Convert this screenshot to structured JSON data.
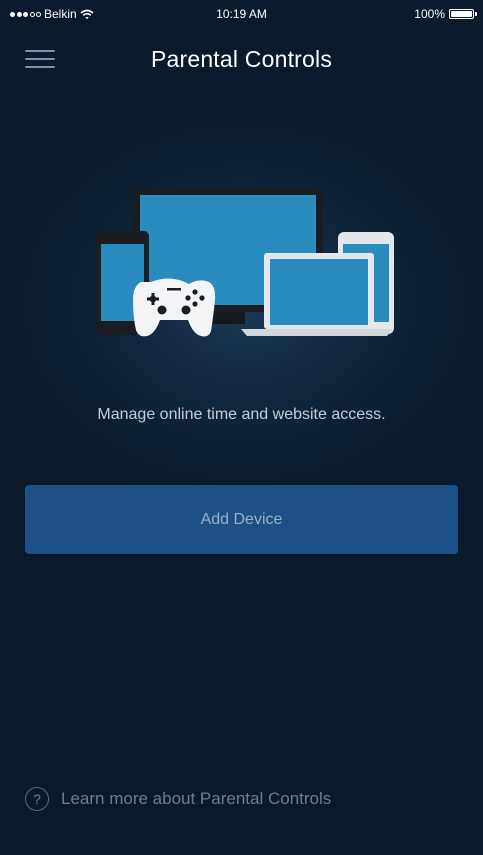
{
  "status_bar": {
    "carrier": "Belkin",
    "time": "10:19 AM",
    "battery": "100%"
  },
  "header": {
    "title": "Parental Controls",
    "menu_icon": "hamburger-menu-icon"
  },
  "illustration": {
    "name": "devices-illustration",
    "devices": [
      "monitor",
      "smartphone",
      "game-controller",
      "laptop",
      "tablet"
    ]
  },
  "main": {
    "description": "Manage online time and website access.",
    "add_device_label": "Add Device"
  },
  "footer": {
    "learn_more_label": "Learn more about Parental Controls",
    "help_icon_glyph": "?"
  },
  "colors": {
    "background": "#0a1a2c",
    "button": "#1d5185",
    "button_text": "#94b2cf",
    "device_screen": "#2a8bbf"
  }
}
